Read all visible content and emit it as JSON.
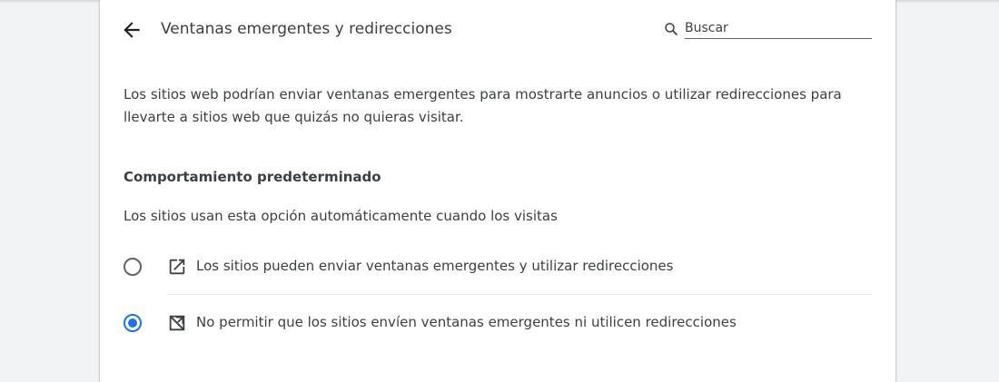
{
  "header": {
    "title": "Ventanas emergentes y redirecciones",
    "back_icon": "arrow-back-icon"
  },
  "search": {
    "placeholder": "Buscar",
    "icon": "search-icon"
  },
  "description": "Los sitios web podrían enviar ventanas emergentes para mostrarte anuncios o utilizar redirecciones para llevarte a sitios web que quizás no quieras visitar.",
  "default_behavior": {
    "heading": "Comportamiento predeterminado",
    "subtitle": "Los sitios usan esta opción automáticamente cuando los visitas",
    "options": [
      {
        "label": "Los sitios pueden enviar ventanas emergentes y utilizar redirecciones",
        "icon": "open-in-new-icon",
        "selected": false
      },
      {
        "label": "No permitir que los sitios envíen ventanas emergentes ni utilicen redirecciones",
        "icon": "popup-blocked-icon",
        "selected": true
      }
    ]
  },
  "colors": {
    "accent": "#1a73e8",
    "text": "#3c4043",
    "background": "#f1f3f4",
    "card": "#ffffff"
  }
}
